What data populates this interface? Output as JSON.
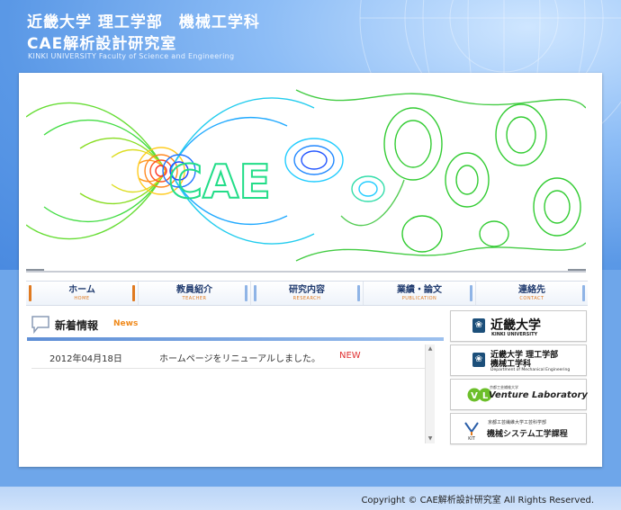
{
  "header": {
    "title_line1": "近畿大学 理工学部　機械工学科",
    "title_line2": "CAE解析設計研究室",
    "subtitle": "KINKI UNIVERSITY Faculty of Science and Engineering"
  },
  "hero": {
    "logo_text": "CAE"
  },
  "nav": {
    "items": [
      {
        "label": "ホーム",
        "sub": "HOME"
      },
      {
        "label": "教員紹介",
        "sub": "TEACHER"
      },
      {
        "label": "研究内容",
        "sub": "RESEARCH"
      },
      {
        "label": "業績・論文",
        "sub": "PUBLICATION"
      },
      {
        "label": "連絡先",
        "sub": "CONTACT"
      }
    ]
  },
  "news": {
    "title": "新着情報",
    "title_en": "News",
    "items": [
      {
        "date": "2012年04月18日",
        "text": "ホームページをリニューアルしました。",
        "badge": "NEW"
      }
    ]
  },
  "banners": {
    "kindai": {
      "name": "近畿大学",
      "sub": "KINKI UNIVERSITY"
    },
    "dept": {
      "name1": "近畿大学 理工学部",
      "name2": "機械工学科",
      "sub": "Department of Mechanical Engineering"
    },
    "venture": {
      "small": "京都工芸繊維大学",
      "name": "Venture Laboratory"
    },
    "kit": {
      "small": "京都工芸繊維大学工芸科学部",
      "name": "機械システム工学課程"
    }
  },
  "footer": {
    "copyright": "Copyright © CAE解析設計研究室 All Rights Reserved."
  },
  "colors": {
    "accent_orange": "#f08a1c",
    "nav_blue": "#1f3a6e",
    "news_new": "#e03030"
  }
}
